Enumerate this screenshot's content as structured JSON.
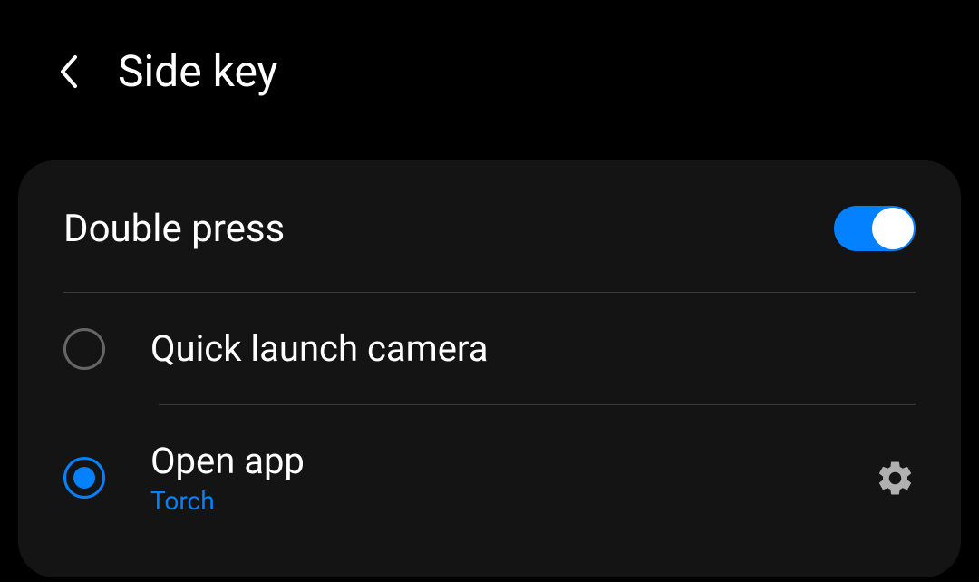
{
  "header": {
    "title": "Side key"
  },
  "section": {
    "title": "Double press",
    "toggle_on": true
  },
  "options": [
    {
      "label": "Quick launch camera",
      "sublabel": null,
      "selected": false,
      "has_settings": false
    },
    {
      "label": "Open app",
      "sublabel": "Torch",
      "selected": true,
      "has_settings": true
    }
  ]
}
